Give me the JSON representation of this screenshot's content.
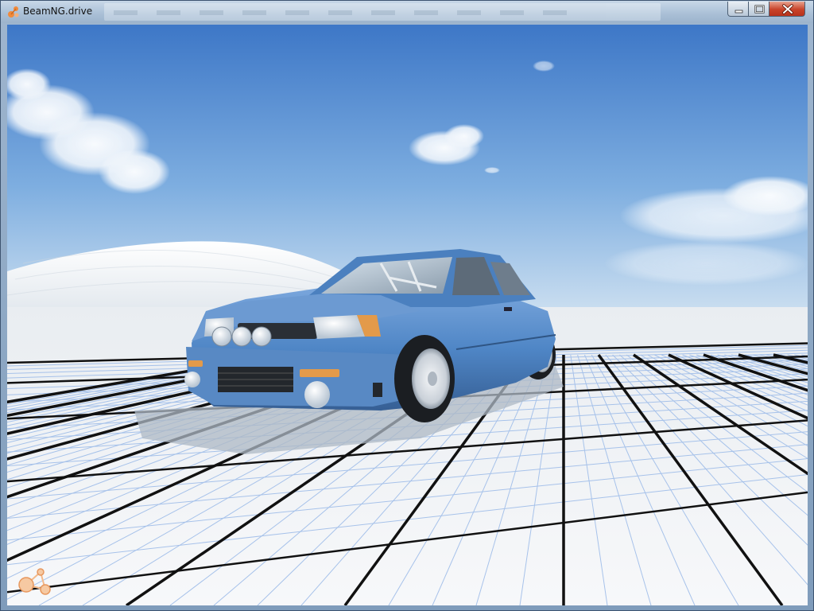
{
  "window": {
    "title": "BeamNG.drive"
  },
  "icons": {
    "app": "beamng-app-icon",
    "minimize": "minimize-icon",
    "maximize": "maximize-icon",
    "close": "close-icon",
    "logo": "beamng-logo-icon"
  },
  "scene": {
    "vehicle_color": "#4f86c6",
    "sky_top": "#3f78c8",
    "sky_horizon": "#c6dcf0",
    "ground": "#f4f6f8",
    "grid_major": "#111111",
    "grid_minor": "#8fb2e6",
    "accent": "#f0a060"
  }
}
